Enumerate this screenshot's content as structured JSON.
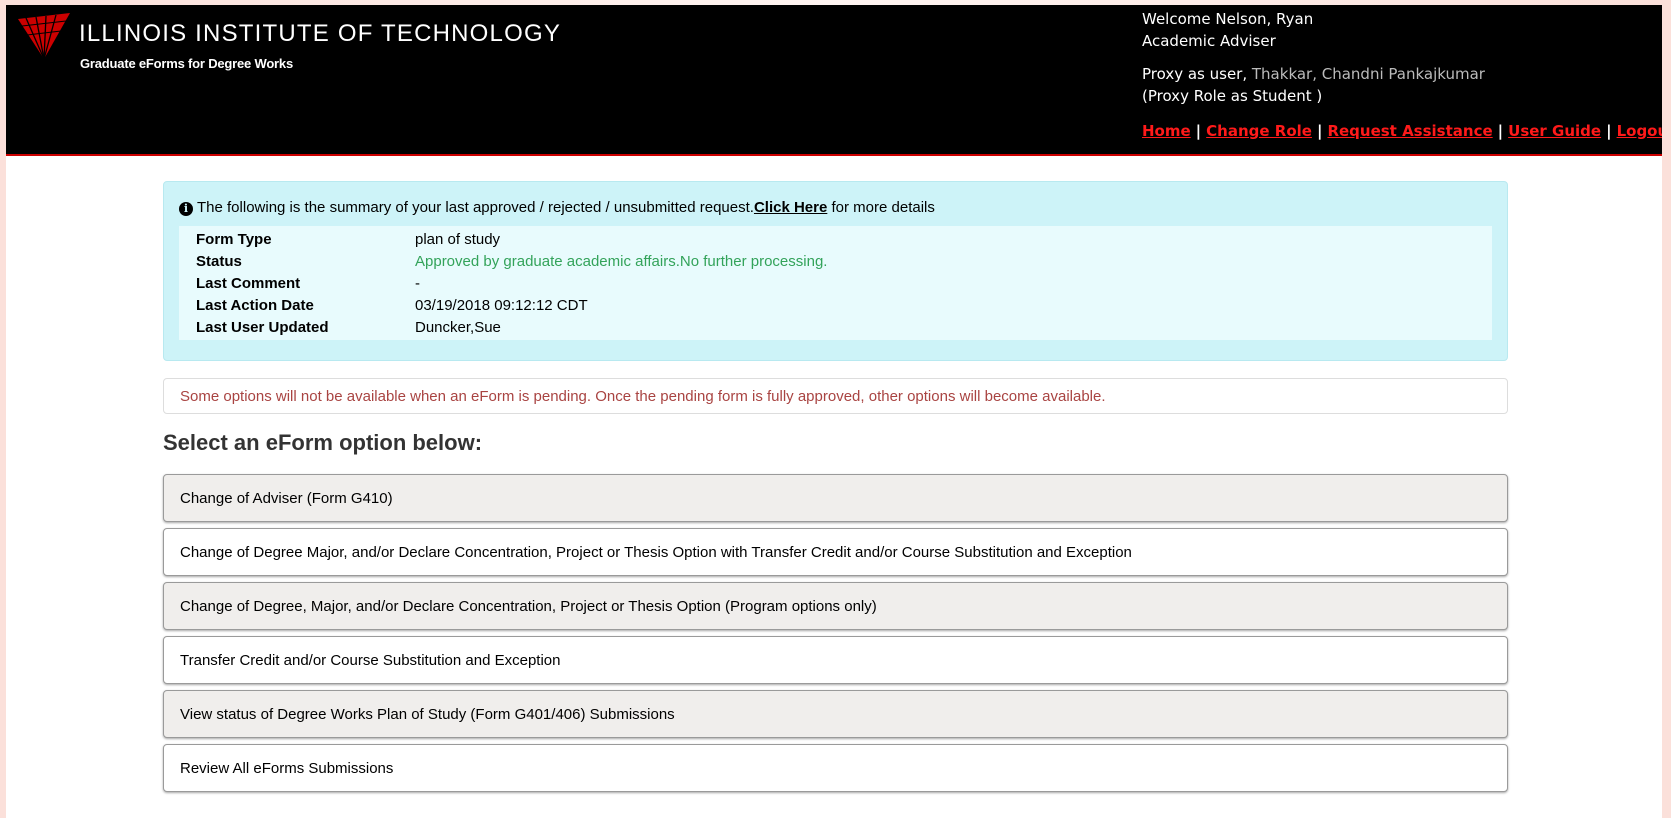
{
  "brand": {
    "name": "ILLINOIS INSTITUTE OF TECHNOLOGY",
    "subtitle": "Graduate eForms for Degree Works"
  },
  "user": {
    "welcome": "Welcome Nelson, Ryan",
    "role": "Academic Adviser",
    "proxy_prefix": "Proxy as user, ",
    "proxy_name": "Thakkar, Chandni Pankajkumar",
    "proxy_role": "(Proxy Role as Student )"
  },
  "nav": {
    "home": "Home",
    "change_role": "Change Role",
    "request_assistance": "Request Assistance",
    "user_guide": "User Guide",
    "logout": "Logout",
    "separator": "|"
  },
  "summary": {
    "icon": "info-circle-icon",
    "intro": "The following is the summary of your last approved / rejected / unsubmitted request.",
    "link": "Click Here",
    "outro": " for more details",
    "rows": [
      {
        "label": "Form Type",
        "value": "plan of study"
      },
      {
        "label": "Status",
        "value": "Approved by graduate academic affairs.No further processing."
      },
      {
        "label": "Last Comment",
        "value": "-"
      },
      {
        "label": "Last Action Date",
        "value": "03/19/2018 09:12:12 CDT"
      },
      {
        "label": "Last User Updated",
        "value": "Duncker,Sue"
      }
    ]
  },
  "notice": "Some options will not be available when an eForm is pending. Once the pending form is fully approved, other options will become available.",
  "section_title": "Select an eForm option below:",
  "options": [
    "Change of Adviser (Form G410)",
    "Change of Degree Major, and/or Declare Concentration, Project or Thesis Option with Transfer Credit and/or Course Substitution and Exception",
    "Change of Degree, Major, and/or Declare Concentration, Project or Thesis Option (Program options only)",
    "Transfer Credit and/or Course Substitution and Exception",
    "View status of Degree Works Plan of Study (Form G401/406) Submissions",
    "Review All eForms Submissions"
  ],
  "colors": {
    "header_bg": "#000000",
    "nav_link": "#ff1a1a",
    "summary_bg": "#cdf3f8",
    "status_text": "#33a35a",
    "notice_text": "#a94442",
    "logo_red": "#cc0000"
  }
}
